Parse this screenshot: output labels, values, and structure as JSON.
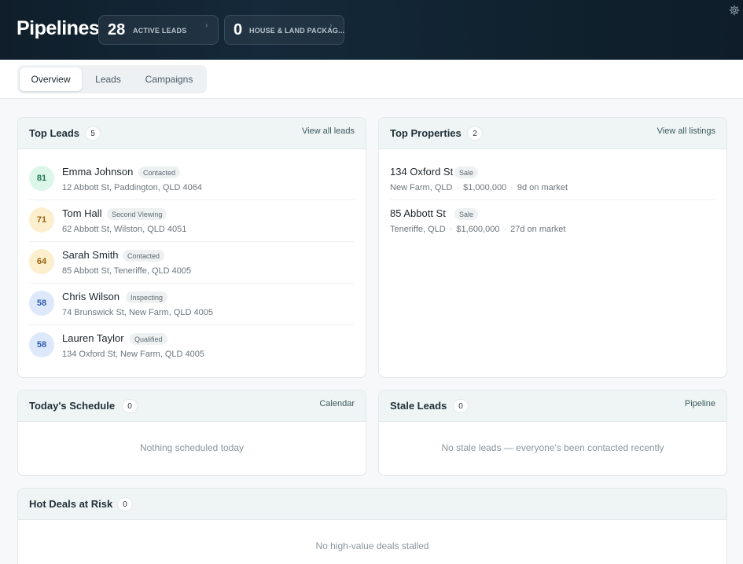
{
  "header": {
    "title": "Pipelines",
    "stats": [
      {
        "value": "28",
        "label": "ACTIVE LEADS",
        "chevron": "›"
      },
      {
        "value": "0",
        "label": "HOUSE & LAND PACKAG...",
        "chevron": "›"
      }
    ],
    "settings_icon": "gear-icon"
  },
  "tabs": [
    "Overview",
    "Leads",
    "Campaigns"
  ],
  "active_tab": "Overview",
  "top_leads": {
    "title": "Top Leads",
    "count": "5",
    "link": "View all leads",
    "items": [
      {
        "score": "81",
        "name": "Emma Johnson",
        "status": "Contacted",
        "address": "12 Abbott St, Paddington, QLD 4064",
        "tone": "green"
      },
      {
        "score": "71",
        "name": "Tom Hall",
        "status": "Second Viewing",
        "address": "62 Abbott St, Wilston, QLD 4051",
        "tone": "amber"
      },
      {
        "score": "64",
        "name": "Sarah Smith",
        "status": "Contacted",
        "address": "85 Abbott St, Teneriffe, QLD 4005",
        "tone": "amber"
      },
      {
        "score": "58",
        "name": "Chris Wilson",
        "status": "Inspecting",
        "address": "74 Brunswick St, New Farm, QLD 4005",
        "tone": "blue"
      },
      {
        "score": "58",
        "name": "Lauren Taylor",
        "status": "Qualified",
        "address": "134 Oxford St, New Farm, QLD 4005",
        "tone": "blue"
      }
    ]
  },
  "top_properties": {
    "title": "Top Properties",
    "count": "2",
    "link": "View all listings",
    "items": [
      {
        "name": "134 Oxford St",
        "type": "Sale",
        "suburb": "New Farm, QLD",
        "price": "$1,000,000",
        "days": "9d on market"
      },
      {
        "name": "85 Abbott St",
        "type": "Sale",
        "suburb": "Teneriffe, QLD",
        "price": "$1,600,000",
        "days": "27d on market"
      }
    ]
  },
  "schedule": {
    "title": "Today's Schedule",
    "count": "0",
    "link": "Calendar",
    "empty": "Nothing scheduled today"
  },
  "stale": {
    "title": "Stale Leads",
    "count": "0",
    "link": "Pipeline",
    "empty": "No stale leads — everyone's been contacted recently"
  },
  "hot_deals": {
    "title": "Hot Deals at Risk",
    "count": "0",
    "empty": "No high-value deals stalled"
  },
  "colors": {
    "header_bg": "#10222f",
    "card_head_bg": "#eff5f4",
    "score_green": "#dcf6ea",
    "score_amber": "#fcefcd",
    "score_blue": "#dde9fb"
  }
}
